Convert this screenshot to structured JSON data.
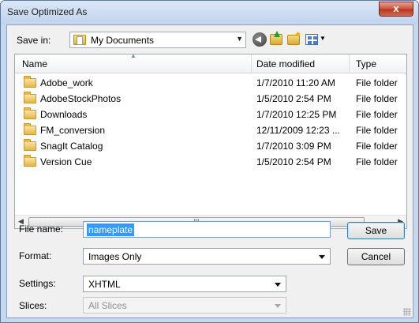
{
  "window": {
    "title": "Save Optimized As",
    "close_glyph": "x"
  },
  "toolbar": {
    "save_in_label": "Save in:",
    "save_in_value": "My Documents",
    "icons": [
      "back-icon",
      "up-folder-icon",
      "new-folder-icon",
      "views-menu-icon"
    ]
  },
  "file_list": {
    "columns": [
      "Name",
      "Date modified",
      "Type"
    ],
    "rows": [
      {
        "name": "Adobe_work",
        "date": "1/7/2010 11:20 AM",
        "type": "File folder"
      },
      {
        "name": "AdobeStockPhotos",
        "date": "1/5/2010 2:54 PM",
        "type": "File folder"
      },
      {
        "name": "Downloads",
        "date": "1/7/2010 12:25 PM",
        "type": "File folder"
      },
      {
        "name": "FM_conversion",
        "date": "12/11/2009 12:23 ...",
        "type": "File folder"
      },
      {
        "name": "SnagIt Catalog",
        "date": "1/7/2010 3:09 PM",
        "type": "File folder"
      },
      {
        "name": "Version Cue",
        "date": "1/5/2010 2:54 PM",
        "type": "File folder"
      }
    ],
    "scroll_thumb_glyph": "III"
  },
  "form": {
    "file_name_label": "File name:",
    "file_name_value": "nameplate",
    "format_label": "Format:",
    "format_value": "Images Only",
    "settings_label": "Settings:",
    "settings_value": "XHTML",
    "slices_label": "Slices:",
    "slices_value": "All Slices"
  },
  "buttons": {
    "save": "Save",
    "cancel": "Cancel"
  },
  "colors": {
    "selection": "#3399ff",
    "frame": "#c6d8ee",
    "close": "#c95b45"
  }
}
